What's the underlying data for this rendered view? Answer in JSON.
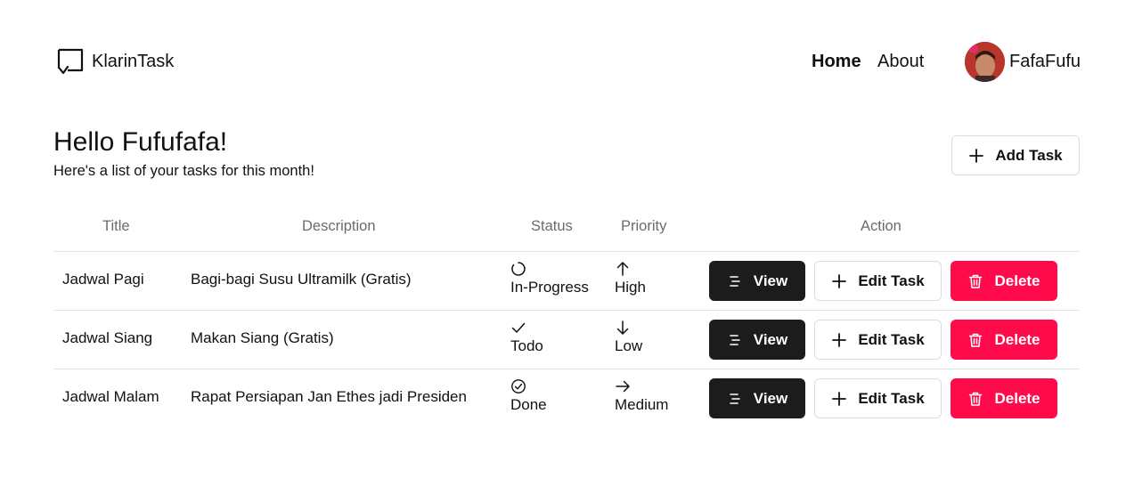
{
  "app": {
    "name": "KlarinTask"
  },
  "nav": {
    "home": "Home",
    "about": "About"
  },
  "user": {
    "name": "FafaFufu"
  },
  "greeting": {
    "title": "Hello Fufufafa!",
    "subtitle": "Here's a list of your tasks for this month!"
  },
  "actions": {
    "add_task": "Add Task"
  },
  "table": {
    "headers": {
      "title": "Title",
      "description": "Description",
      "status": "Status",
      "priority": "Priority",
      "action": "Action"
    },
    "rows": [
      {
        "title": "Jadwal Pagi",
        "description": "Bagi-bagi Susu Ultramilk (Gratis)",
        "status": "In-Progress",
        "status_icon": "progress-circle-icon",
        "priority": "High",
        "priority_icon": "arrow-up-icon"
      },
      {
        "title": "Jadwal Siang",
        "description": "Makan Siang (Gratis)",
        "status": "Todo",
        "status_icon": "check-icon",
        "priority": "Low",
        "priority_icon": "arrow-down-icon"
      },
      {
        "title": "Jadwal Malam",
        "description": "Rapat Persiapan Jan Ethes jadi Presiden",
        "status": "Done",
        "status_icon": "check-circle-icon",
        "priority": "Medium",
        "priority_icon": "arrow-right-icon"
      }
    ],
    "row_actions": {
      "view": "View",
      "edit": "Edit Task",
      "delete": "Delete"
    }
  },
  "colors": {
    "primary": "#1c1c1c",
    "danger": "#ff0a4a",
    "border": "#dcdcdc"
  }
}
